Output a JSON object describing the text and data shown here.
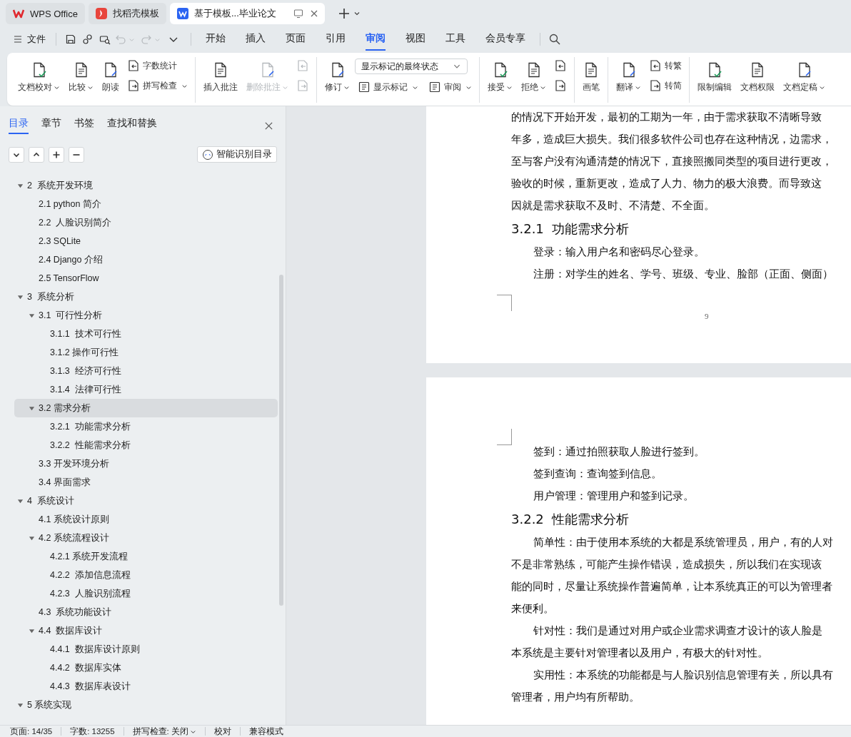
{
  "tabs": [
    {
      "label": "WPS Office",
      "kind": "home",
      "selected": false
    },
    {
      "label": "找稻壳模板",
      "kind": "template",
      "selected": false
    },
    {
      "label": "基于模板...毕业论文",
      "kind": "document",
      "selected": true
    }
  ],
  "menu": {
    "file": "文件",
    "quick_access": [
      {
        "kind": "save",
        "disabled": false
      },
      {
        "kind": "share",
        "disabled": false
      },
      {
        "kind": "preview",
        "disabled": false
      },
      {
        "kind": "undo",
        "disabled": true
      },
      {
        "kind": "redo",
        "disabled": true
      },
      {
        "kind": "more",
        "disabled": false
      }
    ],
    "tabs": [
      {
        "label": "开始",
        "selected": false
      },
      {
        "label": "插入",
        "selected": false
      },
      {
        "label": "页面",
        "selected": false
      },
      {
        "label": "引用",
        "selected": false
      },
      {
        "label": "审阅",
        "selected": true
      },
      {
        "label": "视图",
        "selected": false
      },
      {
        "label": "工具",
        "selected": false
      },
      {
        "label": "会员专享",
        "selected": false
      }
    ]
  },
  "ribbon": [
    {
      "columns": [
        {
          "kind": "big",
          "label": "文档校对",
          "caret": true,
          "disabled": false
        },
        {
          "kind": "big",
          "label": "比较",
          "caret": true,
          "disabled": false
        },
        {
          "kind": "big",
          "label": "朗读",
          "caret": false,
          "disabled": false
        },
        {
          "kind": "stack",
          "items": [
            {
              "label": "字数统计",
              "caret": false,
              "disabled": false
            },
            {
              "label": "拼写检查",
              "caret": true,
              "disabled": false
            }
          ]
        }
      ]
    },
    {
      "columns": [
        {
          "kind": "big",
          "label": "插入批注",
          "caret": false,
          "disabled": false
        },
        {
          "kind": "big",
          "label": "删除批注",
          "caret": true,
          "disabled": true
        },
        {
          "kind": "stack",
          "items": [
            {
              "caret": false,
              "disabled": true
            },
            {
              "caret": false,
              "disabled": true
            }
          ]
        }
      ]
    },
    {
      "columns": [
        {
          "kind": "big",
          "label": "修订",
          "caret": true,
          "disabled": false
        },
        {
          "kind": "select",
          "value": "显示标记的最终状态",
          "items": [
            {
              "label": "显示标记",
              "caret": true,
              "disabled": false
            },
            {
              "label": "审阅",
              "caret": true,
              "disabled": false
            }
          ]
        }
      ]
    },
    {
      "columns": [
        {
          "kind": "big",
          "label": "接受",
          "caret": true,
          "disabled": false
        },
        {
          "kind": "big",
          "label": "拒绝",
          "caret": true,
          "disabled": false
        },
        {
          "kind": "stack",
          "items": [
            {
              "caret": false,
              "disabled": false
            },
            {
              "caret": false,
              "disabled": false
            }
          ]
        }
      ]
    },
    {
      "columns": [
        {
          "kind": "big",
          "label": "画笔",
          "caret": false,
          "disabled": false
        }
      ]
    },
    {
      "columns": [
        {
          "kind": "big",
          "label": "翻译",
          "caret": true,
          "disabled": false
        },
        {
          "kind": "stack",
          "items": [
            {
              "label": "转繁",
              "caret": false,
              "disabled": false
            },
            {
              "label": "转简",
              "caret": false,
              "disabled": false
            }
          ]
        }
      ]
    },
    {
      "columns": [
        {
          "kind": "big",
          "label": "限制编辑",
          "caret": false,
          "disabled": false
        },
        {
          "kind": "big",
          "label": "文档权限",
          "caret": false,
          "disabled": false
        },
        {
          "kind": "big",
          "label": "文档定稿",
          "caret": true,
          "disabled": false
        }
      ]
    }
  ],
  "sidebar": {
    "tabs": [
      {
        "label": "目录",
        "selected": true
      },
      {
        "label": "章节",
        "selected": false
      },
      {
        "label": "书签",
        "selected": false
      },
      {
        "label": "查找和替换",
        "selected": false
      }
    ],
    "smart_button": "智能识别目录",
    "outline": [
      {
        "title": "2  系统开发环境",
        "expanded": true,
        "selected": false,
        "children": [
          {
            "title": "2.1 python 简介",
            "selected": false
          },
          {
            "title": "2.2  人脸识别简介",
            "selected": false
          },
          {
            "title": "2.3 SQLite",
            "selected": false
          },
          {
            "title": "2.4 Django 介绍",
            "selected": false
          },
          {
            "title": "2.5 TensorFlow",
            "selected": false
          }
        ]
      },
      {
        "title": "3  系统分析",
        "expanded": true,
        "selected": false,
        "children": [
          {
            "title": "3.1  可行性分析",
            "expanded": true,
            "selected": false,
            "children": [
              {
                "title": "3.1.1  技术可行性",
                "selected": false
              },
              {
                "title": "3.1.2 操作可行性",
                "selected": false
              },
              {
                "title": "3.1.3  经济可行性",
                "selected": false
              },
              {
                "title": "3.1.4  法律可行性",
                "selected": false
              }
            ]
          },
          {
            "title": "3.2 需求分析",
            "expanded": true,
            "selected": true,
            "children": [
              {
                "title": "3.2.1  功能需求分析",
                "selected": false
              },
              {
                "title": "3.2.2  性能需求分析",
                "selected": false
              }
            ]
          },
          {
            "title": "3.3 开发环境分析",
            "selected": false
          },
          {
            "title": "3.4 界面需求",
            "selected": false
          }
        ]
      },
      {
        "title": "4  系统设计",
        "expanded": true,
        "selected": false,
        "children": [
          {
            "title": "4.1 系统设计原则",
            "selected": false
          },
          {
            "title": "4.2 系统流程设计",
            "expanded": true,
            "selected": false,
            "children": [
              {
                "title": "4.2.1 系统开发流程",
                "selected": false
              },
              {
                "title": "4.2.2  添加信息流程",
                "selected": false
              },
              {
                "title": "4.2.3  人脸识别流程",
                "selected": false
              }
            ]
          },
          {
            "title": "4.3  系统功能设计",
            "selected": false
          },
          {
            "title": "4.4  数据库设计",
            "expanded": true,
            "selected": false,
            "children": [
              {
                "title": "4.4.1  数据库设计原则",
                "selected": false
              },
              {
                "title": "4.4.2  数据库实体",
                "selected": false
              },
              {
                "title": "4.4.3  数据库表设计",
                "selected": false
              }
            ]
          }
        ]
      },
      {
        "title": "5 系统实现",
        "expanded": true,
        "selected": false
      }
    ]
  },
  "document": {
    "pages": [
      {
        "blocks": [
          {
            "kind": "line",
            "indent": false,
            "text": "的情况下开始开发，最初的工期为一年，由于需求获取不清晰导致"
          },
          {
            "kind": "line",
            "indent": false,
            "text": "年多，造成巨大损失。我们很多软件公司也存在这种情况，边需求，"
          },
          {
            "kind": "line",
            "indent": false,
            "text": "至与客户没有沟通清楚的情况下，直接照搬同类型的项目进行更改，"
          },
          {
            "kind": "line",
            "indent": false,
            "text": "验收的时候，重新更改，造成了人力、物力的极大浪费。而导致这"
          },
          {
            "kind": "line",
            "indent": false,
            "text": "因就是需求获取不及时、不清楚、不全面。"
          },
          {
            "kind": "heading",
            "text": "3.2.1  功能需求分析"
          },
          {
            "kind": "line",
            "indent": true,
            "text": "登录：输入用户名和密码尽心登录。"
          },
          {
            "kind": "line",
            "indent": true,
            "text": "注册：对学生的姓名、学号、班级、专业、脸部（正面、侧面）"
          }
        ],
        "page_number": "9"
      },
      {
        "blocks": [
          {
            "kind": "line",
            "indent": true,
            "text": "签到：通过拍照获取人脸进行签到。"
          },
          {
            "kind": "line",
            "indent": true,
            "text": "签到查询：查询签到信息。"
          },
          {
            "kind": "line",
            "indent": true,
            "text": "用户管理：管理用户和签到记录。"
          },
          {
            "kind": "heading",
            "text": "3.2.2  性能需求分析"
          },
          {
            "kind": "line",
            "indent": true,
            "text": "简单性：由于使用本系统的大都是系统管理员，用户，有的人对"
          },
          {
            "kind": "line",
            "indent": false,
            "text": "不是非常熟练，可能产生操作错误，造成损失，所以我们在实现该"
          },
          {
            "kind": "line",
            "indent": false,
            "text": "能的同时，尽量让系统操作普遍简单，让本系统真正的可以为管理者"
          },
          {
            "kind": "line",
            "indent": false,
            "text": "来便利。"
          },
          {
            "kind": "line",
            "indent": true,
            "text": "针对性：我们是通过对用户或企业需求调查才设计的该人脸是"
          },
          {
            "kind": "line",
            "indent": false,
            "text": "本系统是主要针对管理者以及用户，有极大的针对性。"
          },
          {
            "kind": "line",
            "indent": true,
            "text": "实用性：本系统的功能都是与人脸识别信息管理有关，所以具有"
          },
          {
            "kind": "line",
            "indent": false,
            "text": "管理者，用户均有所帮助。"
          }
        ]
      }
    ]
  },
  "status_bar": [
    {
      "text": "页面: 14/35",
      "caret": false
    },
    {
      "text": "字数: 13255",
      "caret": false
    },
    {
      "text": "拼写检查: 关闭",
      "caret": true
    },
    {
      "text": "校对",
      "caret": false
    },
    {
      "text": "兼容模式",
      "caret": false
    }
  ]
}
